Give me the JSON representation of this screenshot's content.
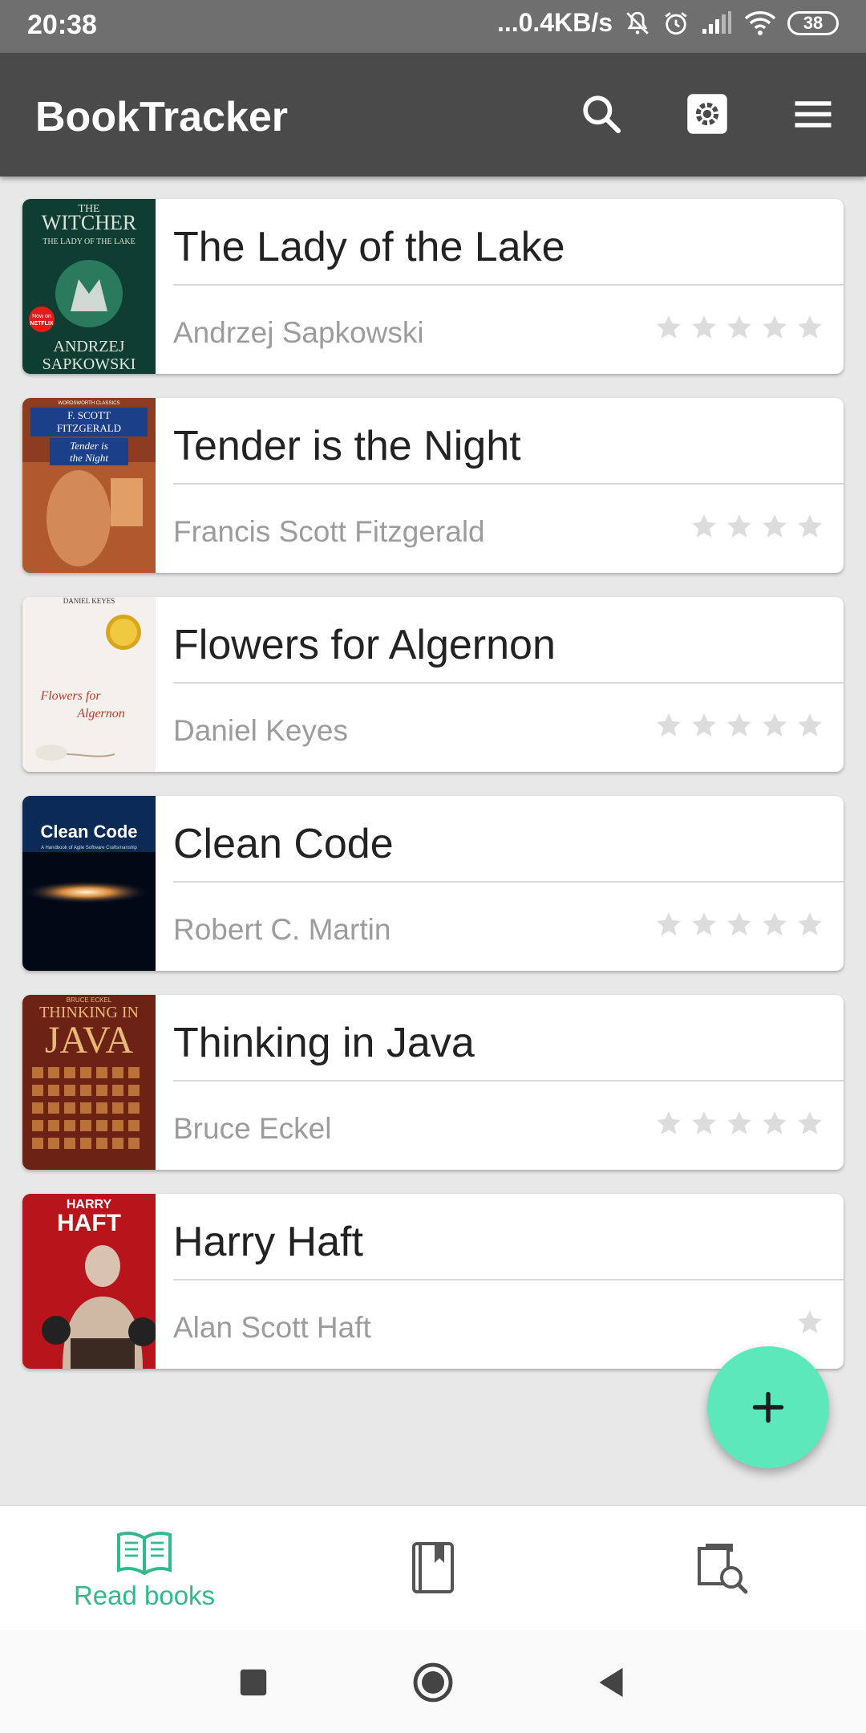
{
  "status_bar": {
    "time": "20:38",
    "network_speed": "...0.4KB/s",
    "battery": "38",
    "icons": [
      "mute-icon",
      "alarm-icon",
      "signal-icon",
      "wifi-icon",
      "battery-icon"
    ]
  },
  "app_bar": {
    "title": "BookTracker",
    "actions": [
      "search-icon",
      "settings-icon",
      "menu-icon"
    ]
  },
  "books": [
    {
      "title": "The Lady of the Lake",
      "author": "Andrzej Sapkowski",
      "stars": 5,
      "cover_colors": [
        "#0f3d31",
        "#1f6b52"
      ],
      "cover_text": [
        "THE",
        "WITCHER",
        "THE LADY OF THE LAKE",
        "Now on",
        "NETFLIX",
        "ANDRZEJ",
        "SAPKOWSKI"
      ]
    },
    {
      "title": "Tender is the Night",
      "author": "Francis Scott Fitzgerald",
      "stars": 4,
      "cover_colors": [
        "#8c3d1f",
        "#c0703a"
      ],
      "cover_text": [
        "WORDSWORTH CLASSICS",
        "F. SCOTT",
        "FITZGERALD",
        "Tender is",
        "the Night"
      ]
    },
    {
      "title": "Flowers for Algernon",
      "author": "Daniel Keyes",
      "stars": 5,
      "cover_colors": [
        "#f4f1ec",
        "#ffffff"
      ],
      "cover_text": [
        "DANIEL KEYES",
        "Flowers for",
        "Algernon"
      ]
    },
    {
      "title": "Clean Code",
      "author": "Robert C. Martin",
      "stars": 5,
      "cover_colors": [
        "#020814",
        "#0b2a55"
      ],
      "cover_text": [
        "Clean Code",
        "A Handbook of Agile Software Craftsmanship"
      ]
    },
    {
      "title": "Thinking in Java",
      "author": "Bruce Eckel",
      "stars": 5,
      "cover_colors": [
        "#6d2216",
        "#9a3c22"
      ],
      "cover_text": [
        "BRUCE ECKEL",
        "THINKING IN",
        "JAVA"
      ]
    },
    {
      "title": "Harry Haft",
      "author": "Alan Scott Haft",
      "stars": 1,
      "cover_colors": [
        "#b8141b",
        "#d8252c"
      ],
      "cover_text": [
        "HARRY",
        "HAFT"
      ]
    }
  ],
  "fab": {
    "icon": "plus-icon"
  },
  "bottom_nav": {
    "items": [
      {
        "label": "Read books",
        "icon": "open-book-icon",
        "active": true
      },
      {
        "label": "",
        "icon": "bookmark-book-icon",
        "active": false
      },
      {
        "label": "",
        "icon": "book-search-icon",
        "active": false
      }
    ]
  },
  "system_nav": [
    "recents-square-icon",
    "home-circle-icon",
    "back-triangle-icon"
  ],
  "colors": {
    "app_bar": "#4a4a4a",
    "status_bar": "#6f6f6f",
    "accent": "#31b98c",
    "fab": "#5de8bc",
    "star_inactive": "#dcdcdc",
    "background": "#e8e8e8"
  }
}
